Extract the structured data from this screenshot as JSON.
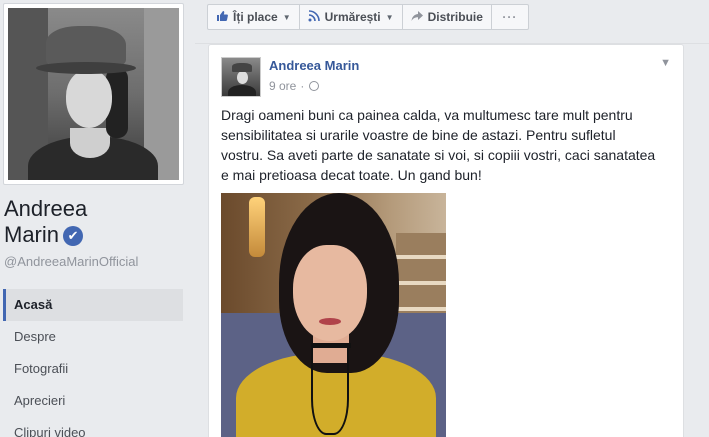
{
  "page": {
    "name_line1": "Andreea",
    "name_line2": "Marin",
    "verified_mark": "✔",
    "handle": "@AndreeaMarinOfficial"
  },
  "nav": {
    "items": [
      {
        "label": "Acasă",
        "active": true
      },
      {
        "label": "Despre"
      },
      {
        "label": "Fotografii"
      },
      {
        "label": "Aprecieri"
      },
      {
        "label": "Clipuri video"
      }
    ]
  },
  "toolbar": {
    "like_label": "Îți place",
    "follow_label": "Urmărești",
    "share_label": "Distribuie",
    "more_label": "···"
  },
  "post": {
    "author": "Andreea Marin",
    "time": "9 ore",
    "separator": "·",
    "text": "Dragi oameni buni ca painea calda, va multumesc tare mult pentru sensibilitatea si urarile voastre de bine de astazi. Pentru sufletul vostru. Sa aveti parte de sanatate si voi, si copiii vostri, caci sanatatea e mai pretioasa decat toate. Un gand bun!"
  },
  "icons": {
    "like": "thumbs-up-icon",
    "follow": "rss-icon",
    "share": "share-arrow-icon",
    "audience": "globe-icon",
    "options": "chevron-down-icon"
  },
  "colors": {
    "brand_blue": "#4267b2",
    "link_blue": "#365899",
    "background": "#e9ebee",
    "muted_text": "#90949c"
  }
}
